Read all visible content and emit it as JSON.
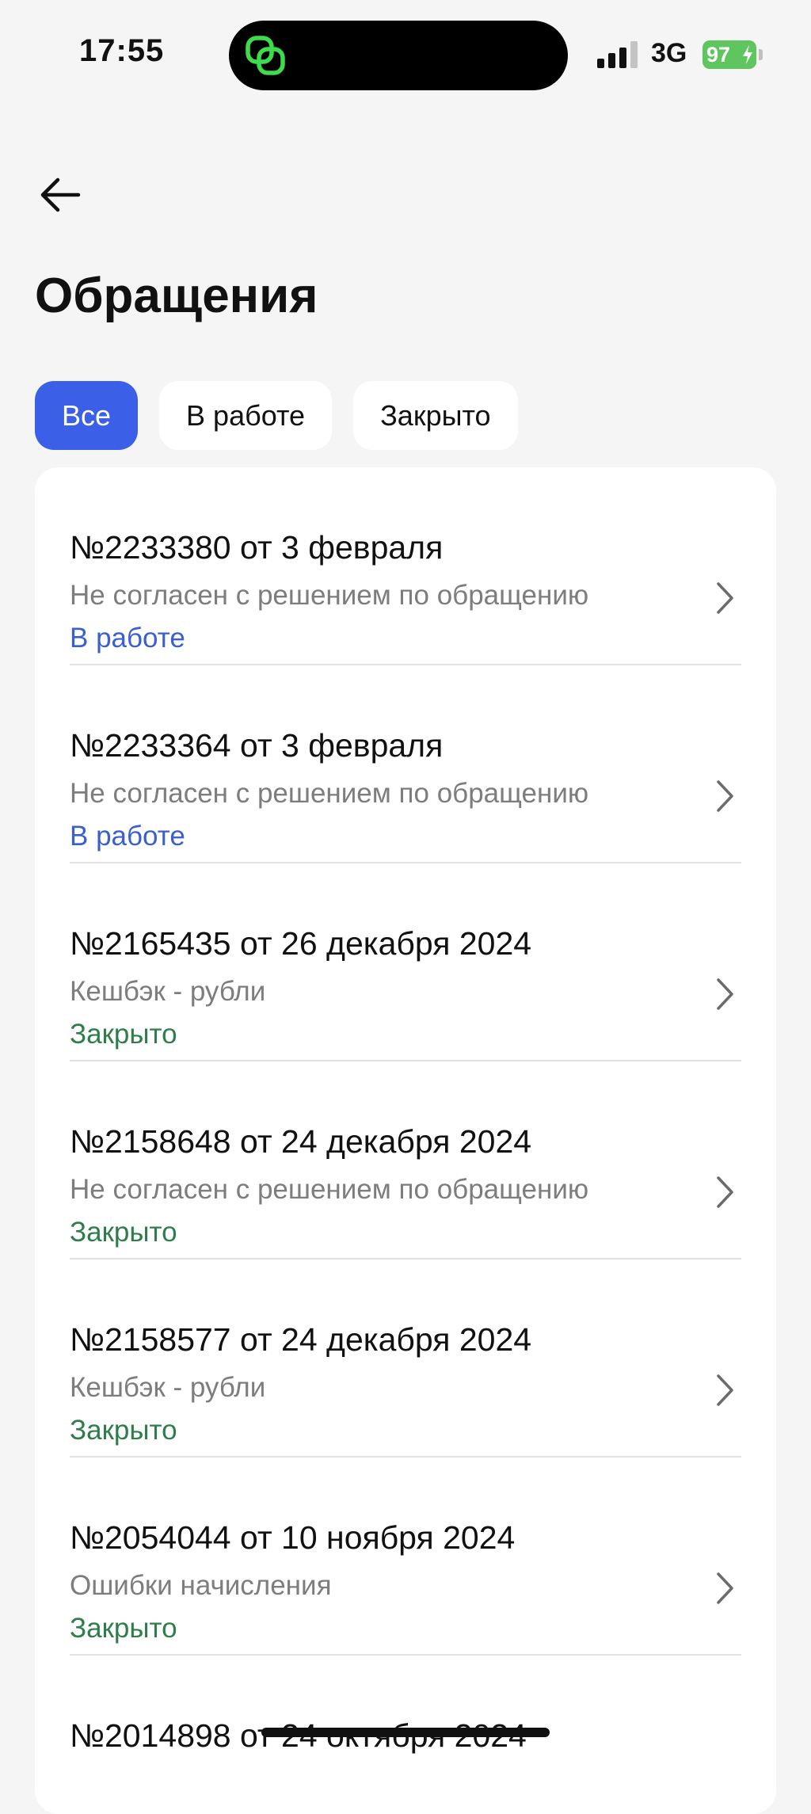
{
  "status_bar": {
    "time": "17:55",
    "network": "3G",
    "battery": "97"
  },
  "header": {
    "title": "Обращения"
  },
  "filters": [
    {
      "label": "Все",
      "active": true
    },
    {
      "label": "В работе",
      "active": false
    },
    {
      "label": "Закрыто",
      "active": false
    }
  ],
  "requests": [
    {
      "title": "№2233380 от 3 февраля",
      "subject": "Не согласен с решением по обращению",
      "status": "В работе"
    },
    {
      "title": "№2233364 от 3 февраля",
      "subject": "Не согласен с решением по обращению",
      "status": "В работе"
    },
    {
      "title": "№2165435 от 26 декабря 2024",
      "subject": "Кешбэк - рубли",
      "status": "Закрыто"
    },
    {
      "title": "№2158648 от 24 декабря 2024",
      "subject": "Не согласен с решением по обращению",
      "status": "Закрыто"
    },
    {
      "title": "№2158577 от 24 декабря 2024",
      "subject": "Кешбэк - рубли",
      "status": "Закрыто"
    },
    {
      "title": "№2054044 от 10 ноября 2024",
      "subject": "Ошибки начисления",
      "status": "Закрыто"
    },
    {
      "title": "№2014898 от 24 октября 2024",
      "subject": "",
      "status": ""
    }
  ],
  "colors": {
    "accent": "#3b5fe6",
    "status_in_progress": "#3b5fd1",
    "status_closed": "#2e7d4a",
    "island_icon": "#3ddc4b"
  }
}
